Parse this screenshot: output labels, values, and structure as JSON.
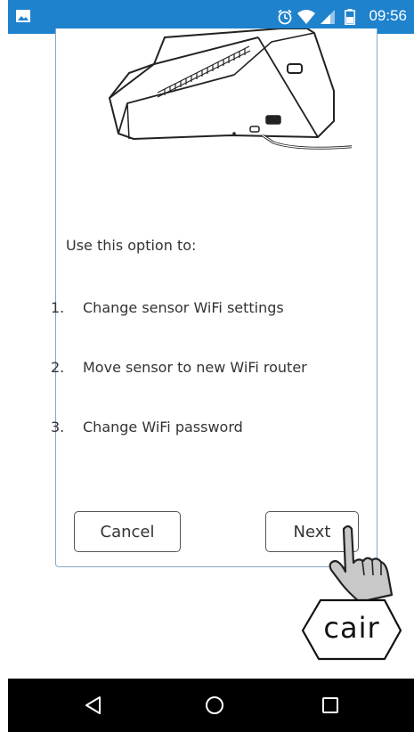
{
  "status_bar": {
    "time": "09:56",
    "icons": [
      "gallery-icon",
      "alarm-icon",
      "wifi-icon",
      "signal-icon",
      "battery-icon"
    ],
    "color": "#1e82cd"
  },
  "card": {
    "intro": "Use this option to:",
    "options": [
      {
        "number": "1.",
        "label": "Change sensor WiFi settings"
      },
      {
        "number": "2.",
        "label": "Move sensor to new WiFi router"
      },
      {
        "number": "3.",
        "label": "Change WiFi password"
      }
    ],
    "cancel_label": "Cancel",
    "next_label": "Next"
  },
  "logo": {
    "text": "cair"
  },
  "nav_bar": {
    "icons": [
      "back-icon",
      "home-icon",
      "recents-icon"
    ]
  }
}
